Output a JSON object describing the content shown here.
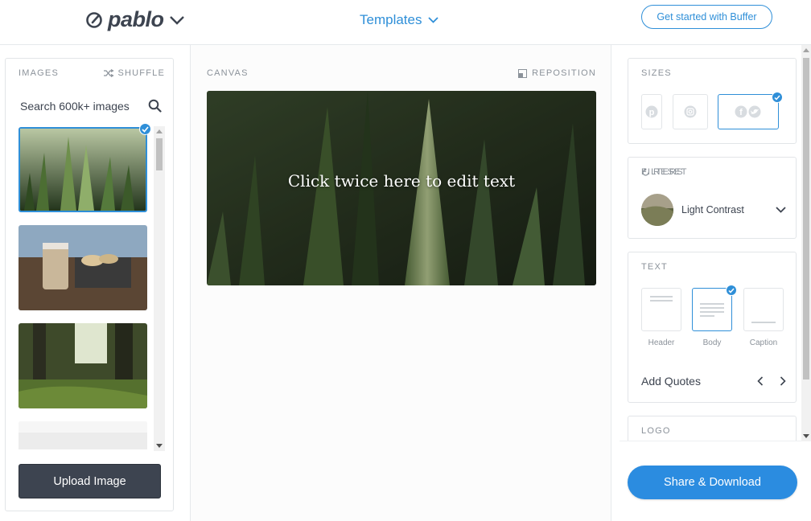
{
  "header": {
    "logo_text": "pablo",
    "templates_label": "Templates",
    "cta_label": "Get started with Buffer"
  },
  "images_panel": {
    "label": "IMAGES",
    "shuffle_label": "SHUFFLE",
    "search_placeholder": "Search 600k+ images",
    "upload_label": "Upload Image"
  },
  "canvas": {
    "label": "CANVAS",
    "reposition_label": "REPOSITION",
    "text": "Click twice here to edit text"
  },
  "sizes": {
    "label": "SIZES",
    "options": [
      "pinterest-icon",
      "instagram-icon",
      "facebook-twitter-icon"
    ],
    "selected": "facebook-twitter-icon"
  },
  "filters": {
    "label": "FILTERS",
    "reset_label": "RESET",
    "selected_filter": "Light Contrast"
  },
  "text_panel": {
    "label": "TEXT",
    "options": [
      {
        "label": "Header"
      },
      {
        "label": "Body"
      },
      {
        "label": "Caption"
      }
    ],
    "selected": "Body",
    "quotes_label": "Add Quotes"
  },
  "logo_panel": {
    "label": "LOGO"
  },
  "share_label": "Share & Download",
  "colors": {
    "accent": "#2f8fd8",
    "dark": "#3d4450",
    "share": "#2b8ce0"
  }
}
